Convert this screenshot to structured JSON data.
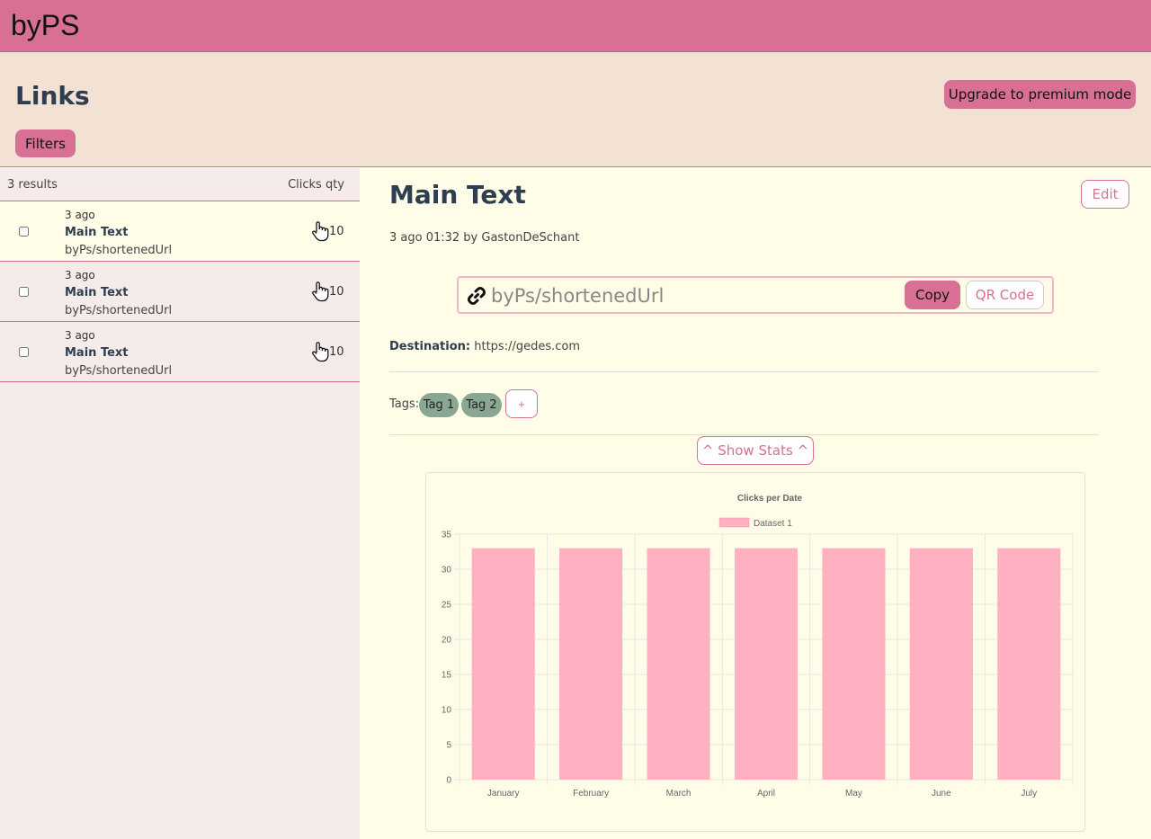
{
  "app": {
    "brand": "byPS"
  },
  "header": {
    "title": "Links",
    "upgrade_label": "Upgrade to premium mode",
    "filters_label": "Filters"
  },
  "list": {
    "results_label": "3 results",
    "clicks_header": "Clicks qty",
    "items": [
      {
        "date": "3 ago",
        "title": "Main Text",
        "url": "byPs/shortenedUrl",
        "clicks": "10"
      },
      {
        "date": "3 ago",
        "title": "Main Text",
        "url": "byPs/shortenedUrl",
        "clicks": "10"
      },
      {
        "date": "3 ago",
        "title": "Main Text",
        "url": "byPs/shortenedUrl",
        "clicks": "10"
      }
    ]
  },
  "detail": {
    "title": "Main Text",
    "edit_label": "Edit",
    "meta": "3 ago 01:32 by GastonDeSchant",
    "short_url": "byPs/shortenedUrl",
    "copy_label": "Copy",
    "qr_label": "QR Code",
    "destination_label": "Destination:",
    "destination_value": "https://gedes.com",
    "tags_label": "Tags:",
    "tags": [
      "Tag 1",
      "Tag 2"
    ],
    "add_tag_label": "+",
    "stats_label": "^ Show Stats ^"
  },
  "colors": {
    "accent": "#d87095",
    "header_bg": "#f3e2d4",
    "bar": "#ffb1c1",
    "tag": "#8aa796"
  },
  "chart_data": {
    "type": "bar",
    "title": "Clicks per Date",
    "categories": [
      "January",
      "February",
      "March",
      "April",
      "May",
      "June",
      "July"
    ],
    "series": [
      {
        "name": "Dataset 1",
        "values": [
          33,
          33,
          33,
          33,
          33,
          33,
          33
        ]
      }
    ],
    "ylim": [
      0,
      35
    ],
    "yticks": [
      "0",
      "5",
      "10",
      "15",
      "20",
      "25",
      "30",
      "35"
    ],
    "grid": true,
    "legend": "top"
  }
}
